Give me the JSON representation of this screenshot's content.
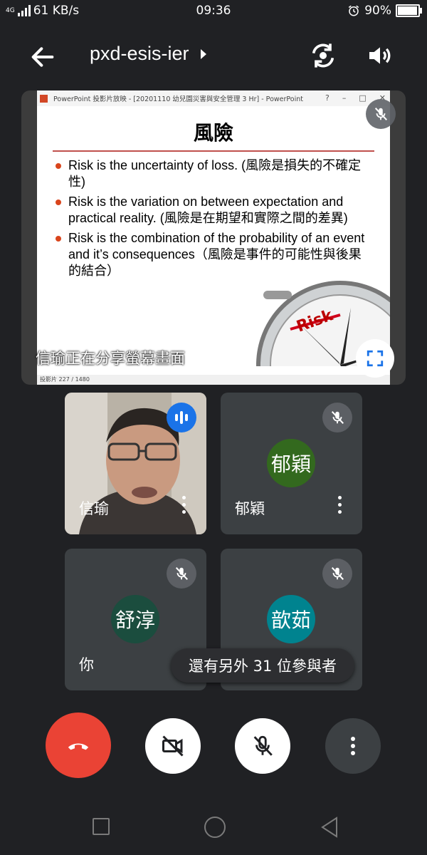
{
  "status_bar": {
    "network_type": "4G",
    "data_speed": "61 KB/s",
    "time": "09:36",
    "battery_percent": "90%",
    "battery_level": 0.9
  },
  "header": {
    "meeting_code": "pxd-esis-ier",
    "icons": [
      "back-arrow-icon",
      "switch-camera-icon",
      "speaker-icon"
    ]
  },
  "presentation": {
    "window_title": "PowerPoint 投影片放映 - [20201110 幼兒園災害與安全管理 3 Hr] - PowerPoint",
    "window_buttons": [
      "?",
      "–",
      "□",
      "✕"
    ],
    "slide_heading": "風險",
    "bullets": [
      "Risk is the uncertainty of loss. (風險是損失的不確定性)",
      "Risk is the variation on between expectation and practical reality. (風險是在期望和實際之間的差異)",
      "Risk is the combination of the probability of an event and it’s consequences（風險是事件的可能性與後果的結合）"
    ],
    "compass_label": "Risk",
    "slide_counter": "投影片 227 / 1480",
    "sharing_text": "信瑜正在分享螢幕畫面",
    "presenter_muted": true
  },
  "participants": [
    {
      "name": "信瑜",
      "type": "video",
      "speaking": true
    },
    {
      "name": "郁穎",
      "avatar_text": "郁穎",
      "avatar_color": "#33691e",
      "muted": true
    },
    {
      "name": "你",
      "avatar_text": "舒淳",
      "avatar_color": "#1b4d3e",
      "muted": true
    },
    {
      "name": "",
      "avatar_text": "歆茹",
      "avatar_color": "#00838f",
      "muted": true
    }
  ],
  "others_count_text": "還有另外 31 位參與者",
  "controls": {
    "hangup": "hangup-icon",
    "camera": "camera-off-icon",
    "mic": "mic-off-icon",
    "more": "more-vert-icon"
  },
  "colors": {
    "background": "#202124",
    "tile": "#3c4043",
    "hangup": "#ea4335",
    "speaking": "#1a73e8"
  }
}
